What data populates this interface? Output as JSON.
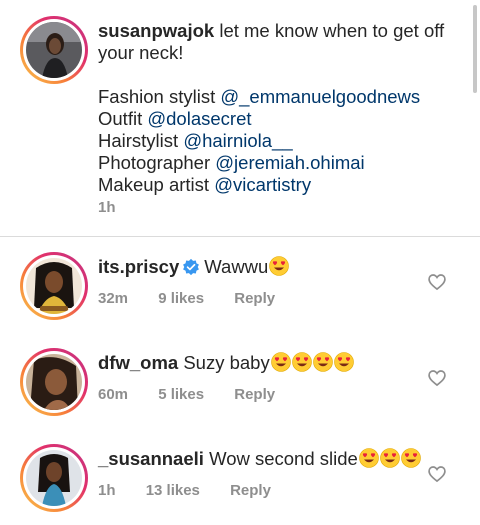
{
  "caption": {
    "username": "susanpwajok",
    "text": "let me know when to get off your neck!",
    "lines": [
      {
        "label": "Fashion stylist",
        "mention": "@_emmanuelgoodnews"
      },
      {
        "label": "Outfit",
        "mention": "@dolasecret"
      },
      {
        "label": "Hairstylist",
        "mention": "@hairniola__"
      },
      {
        "label": "Photographer",
        "mention": "@jeremiah.ohimai"
      },
      {
        "label": "Makeup artist",
        "mention": "@vicartistry"
      }
    ],
    "time": "1h"
  },
  "comments": [
    {
      "username": "its.priscy",
      "verified": true,
      "text": "Wawwu",
      "emoji_count": 1,
      "time": "32m",
      "likes": "9 likes",
      "reply": "Reply"
    },
    {
      "username": "dfw_oma",
      "verified": false,
      "text": "Suzy baby",
      "emoji_count": 4,
      "time": "60m",
      "likes": "5 likes",
      "reply": "Reply"
    },
    {
      "username": "_susannaeli",
      "verified": false,
      "text": "Wow second slide",
      "emoji_count": 3,
      "time": "1h",
      "likes": "13 likes",
      "reply": "Reply"
    }
  ],
  "icons": {
    "heart": "heart-outline-icon",
    "verified": "verified-badge-icon",
    "emoji": "heart-eyes-emoji"
  },
  "colors": {
    "text": "#262626",
    "mention": "#00376b",
    "meta": "#8e8e8e",
    "verified": "#3897f0",
    "divider": "#dbdbdb"
  }
}
